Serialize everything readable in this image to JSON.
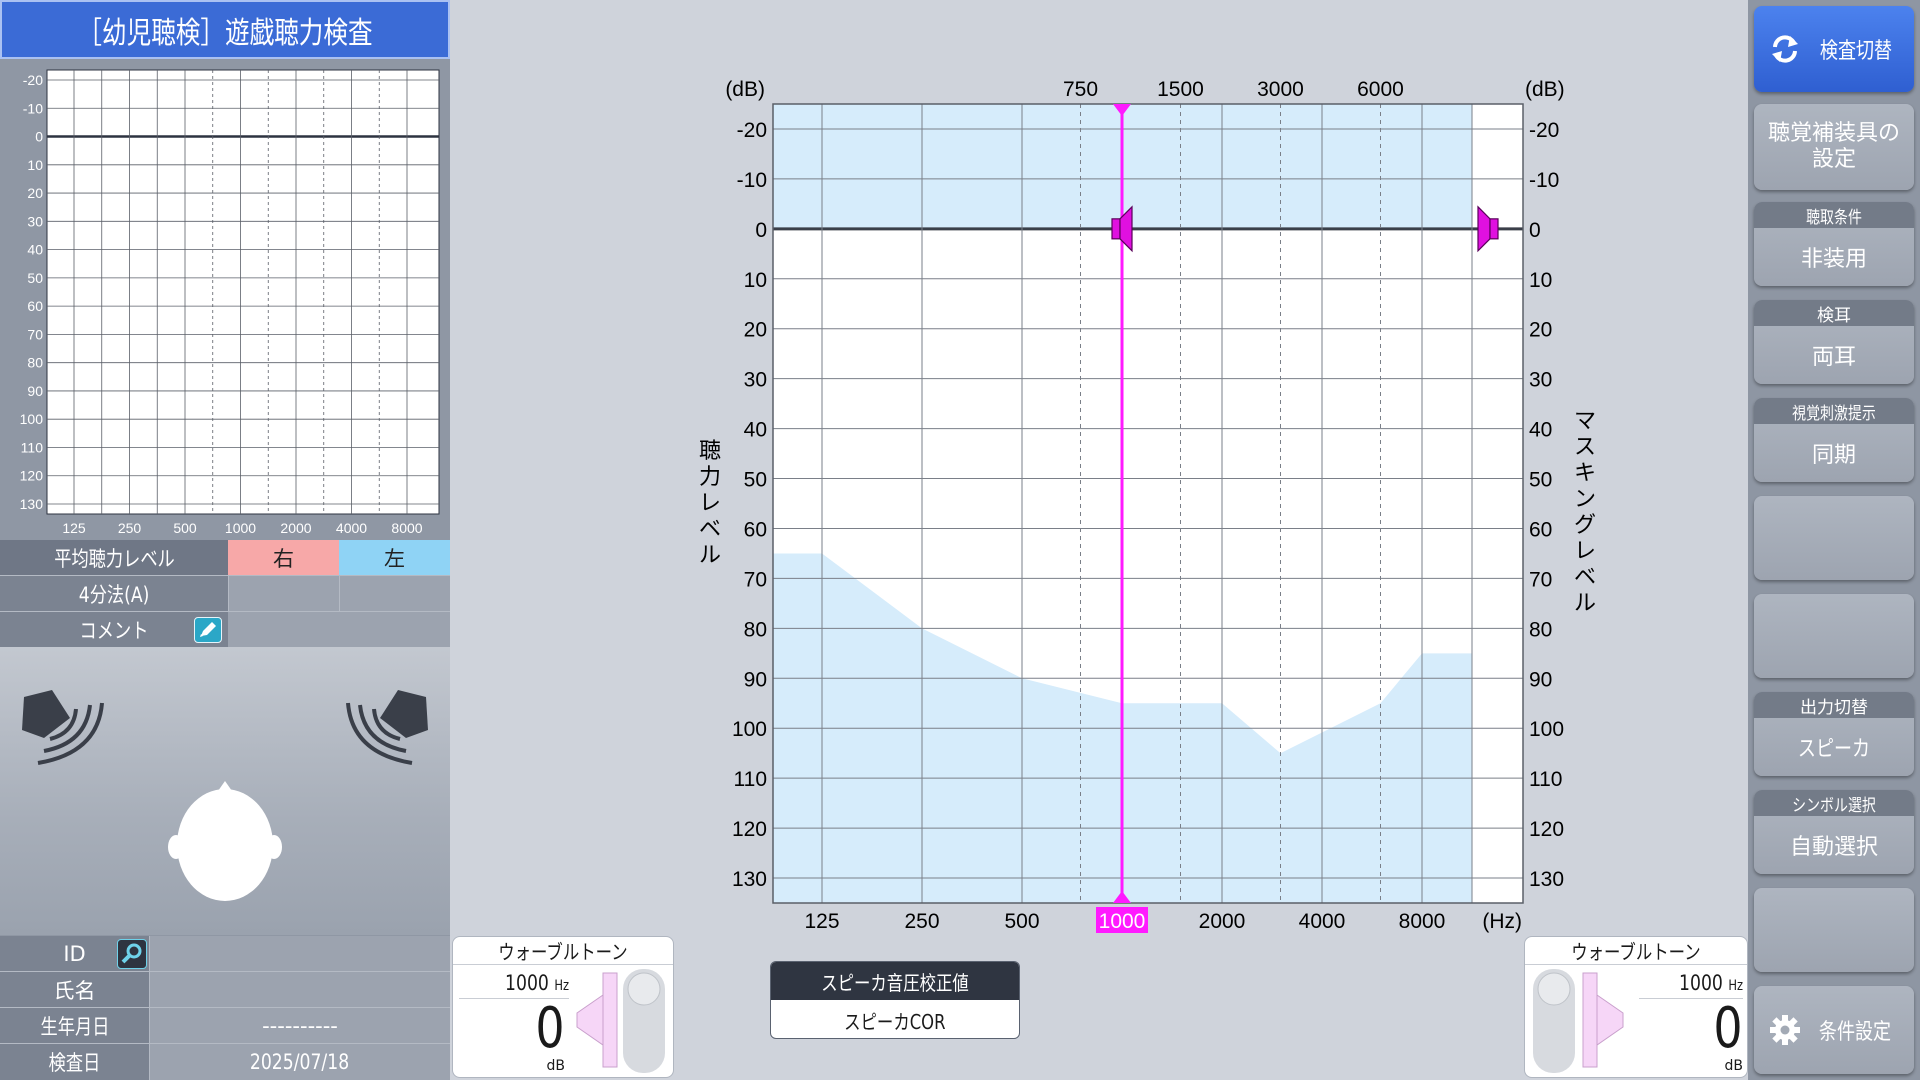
{
  "title": "［幼児聴検］遊戯聴力検査",
  "mini_chart": {
    "y_ticks": [
      "-20",
      "-10",
      "0",
      "10",
      "20",
      "30",
      "40",
      "50",
      "60",
      "70",
      "80",
      "90",
      "100",
      "110",
      "120",
      "130"
    ],
    "x_ticks": [
      "125",
      "250",
      "500",
      "1000",
      "2000",
      "4000",
      "8000"
    ]
  },
  "average_table": {
    "header_label": "平均聴力レベル",
    "right_label": "右",
    "left_label": "左",
    "method_label": "4分法(A)",
    "comment_label": "コメント"
  },
  "patient": {
    "id_label": "ID",
    "name_label": "氏名",
    "birth_label": "生年月日",
    "birth_value": "----------",
    "date_label": "検査日",
    "date_value": "2025/07/18"
  },
  "chart_data": {
    "type": "line",
    "y_label_left": "聴力レベル",
    "y_label_right": "マスキングレベル",
    "y_unit": "(dB)",
    "x_unit": "(Hz)",
    "ylim": [
      -25,
      135
    ],
    "y_ticks": [
      -20,
      -10,
      0,
      10,
      20,
      30,
      40,
      50,
      60,
      70,
      80,
      90,
      100,
      110,
      120,
      130
    ],
    "x_ticks_bottom": [
      "125",
      "250",
      "500",
      "1000",
      "2000",
      "4000",
      "8000"
    ],
    "x_ticks_top": [
      "750",
      "1500",
      "3000",
      "6000"
    ],
    "selected_frequency": "1000",
    "out_of_range_boundary": {
      "x": [
        "125",
        "250",
        "500",
        "1000",
        "2000",
        "3000",
        "6000",
        "8000"
      ],
      "y": [
        65,
        80,
        90,
        95,
        95,
        105,
        95,
        85
      ]
    },
    "cursor": {
      "frequency": "1000",
      "level": 0
    },
    "masking_marker": {
      "level": 0
    }
  },
  "tone_left": {
    "label": "ウォーブルトーン",
    "freq": "1000",
    "freq_unit": "Hz",
    "level": "0",
    "level_unit": "dB"
  },
  "tone_right": {
    "label": "ウォーブルトーン",
    "freq": "1000",
    "freq_unit": "Hz",
    "level": "0",
    "level_unit": "dB"
  },
  "cor": {
    "title": "スピーカ音圧校正値",
    "value": "スピーカCOR"
  },
  "sidebar": {
    "switch_label": "検査切替",
    "hearing_aid_label": "聴覚補装具の設定",
    "listen_caption": "聴取条件",
    "listen_value": "非装用",
    "ear_caption": "検耳",
    "ear_value": "両耳",
    "visual_caption": "視覚刺激提示",
    "visual_value": "同期",
    "output_caption": "出力切替",
    "output_value": "スピーカ",
    "symbol_caption": "シンボル選択",
    "symbol_value": "自動選択",
    "settings_label": "条件設定"
  },
  "colors": {
    "accent": "#3b6bd6",
    "cursor": "#ff1aff",
    "shade": "#d6ecfb",
    "right_ear": "#f7a8a8",
    "left_ear": "#8fd3f5"
  }
}
